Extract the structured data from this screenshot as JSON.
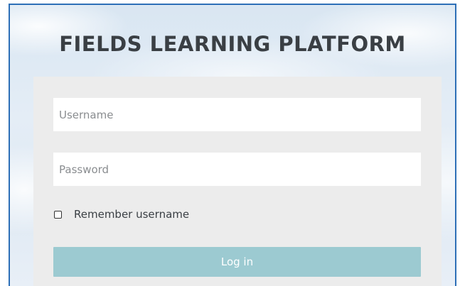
{
  "header": {
    "title": "FIELDS LEARNING PLATFORM"
  },
  "login_form": {
    "username_placeholder": "Username",
    "username_value": "",
    "password_placeholder": "Password",
    "password_value": "",
    "remember_label": "Remember username",
    "remember_checked": false,
    "login_button_label": "Log in"
  },
  "colors": {
    "frame_border": "#2d6fb7",
    "card_background": "#ececec",
    "button_background": "#9ccad1",
    "title_text": "#3a3f44"
  }
}
